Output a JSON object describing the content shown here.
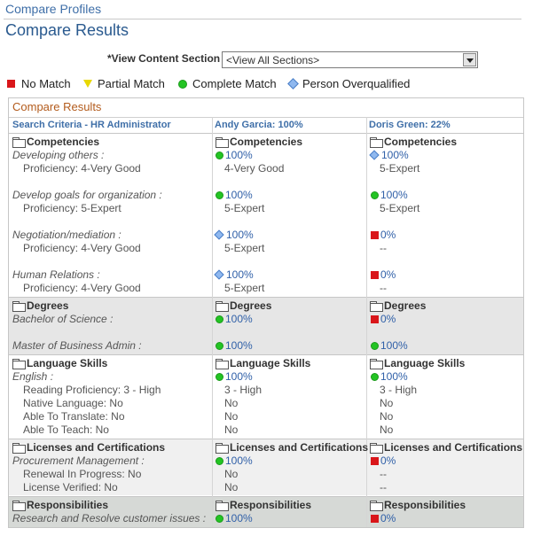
{
  "breadcrumb": "Compare Profiles",
  "page_title": "Compare Results",
  "view": {
    "label": "*View Content Section",
    "selected": "<View All Sections>"
  },
  "legend": {
    "no_match": "No Match",
    "partial_match": "Partial Match",
    "complete_match": "Complete Match",
    "overqualified": "Person Overqualified"
  },
  "colors": {
    "no_match": "#d9161a",
    "partial_match": "#e8d800",
    "complete_match": "#23c423",
    "overqualified": "#8fb8ef",
    "link": "#3f6fa8",
    "results_title": "#b35b1c"
  },
  "results": {
    "title": "Compare Results",
    "columns": [
      "Search Criteria - HR Administrator",
      "Andy Garcia: 100%",
      "Doris Green: 22%"
    ],
    "sections": {
      "competencies": {
        "title": "Competencies",
        "rows": [
          {
            "criterion": "Developing others :",
            "detail": "Proficiency: 4-Very Good",
            "andy": {
              "icon": "complete",
              "pct": "100%",
              "detail": "4-Very Good"
            },
            "doris": {
              "icon": "overqualified",
              "pct": "100%",
              "detail": "5-Expert"
            }
          },
          {
            "criterion": "Develop goals for organization :",
            "detail": "Proficiency: 5-Expert",
            "andy": {
              "icon": "complete",
              "pct": "100%",
              "detail": "5-Expert"
            },
            "doris": {
              "icon": "complete",
              "pct": "100%",
              "detail": "5-Expert"
            }
          },
          {
            "criterion": "Negotiation/mediation :",
            "detail": "Proficiency: 4-Very Good",
            "andy": {
              "icon": "overqualified",
              "pct": "100%",
              "detail": "5-Expert"
            },
            "doris": {
              "icon": "no_match",
              "pct": "0%",
              "detail": "--"
            }
          },
          {
            "criterion": "Human Relations :",
            "detail": "Proficiency: 4-Very Good",
            "andy": {
              "icon": "overqualified",
              "pct": "100%",
              "detail": "5-Expert"
            },
            "doris": {
              "icon": "no_match",
              "pct": "0%",
              "detail": "--"
            }
          }
        ]
      },
      "degrees": {
        "title": "Degrees",
        "rows": [
          {
            "criterion": "Bachelor of Science :",
            "andy": {
              "icon": "complete",
              "pct": "100%"
            },
            "doris": {
              "icon": "no_match",
              "pct": "0%"
            }
          },
          {
            "criterion": "Master of Business Admin :",
            "andy": {
              "icon": "complete",
              "pct": "100%"
            },
            "doris": {
              "icon": "complete",
              "pct": "100%"
            }
          }
        ]
      },
      "language": {
        "title": "Language Skills",
        "criterion": "English :",
        "details": [
          "Reading Proficiency: 3 - High",
          "Native Language: No",
          "Able To Translate: No",
          "Able To Teach: No"
        ],
        "andy": {
          "icon": "complete",
          "pct": "100%",
          "details": [
            "3 - High",
            "No",
            "No",
            "No"
          ]
        },
        "doris": {
          "icon": "complete",
          "pct": "100%",
          "details": [
            "3 - High",
            "No",
            "No",
            "No"
          ]
        }
      },
      "licenses": {
        "title": "Licenses and Certifications",
        "criterion": "Procurement Management :",
        "details": [
          "Renewal In Progress: No",
          "License Verified: No"
        ],
        "andy": {
          "icon": "complete",
          "pct": "100%",
          "details": [
            "No",
            "No"
          ]
        },
        "doris": {
          "icon": "no_match",
          "pct": "0%",
          "details": [
            "--",
            "--"
          ]
        }
      },
      "responsibilities": {
        "title": "Responsibilities",
        "criterion": "Research and Resolve customer issues :",
        "andy": {
          "icon": "complete",
          "pct": "100%"
        },
        "doris": {
          "icon": "no_match",
          "pct": "0%"
        }
      }
    }
  }
}
